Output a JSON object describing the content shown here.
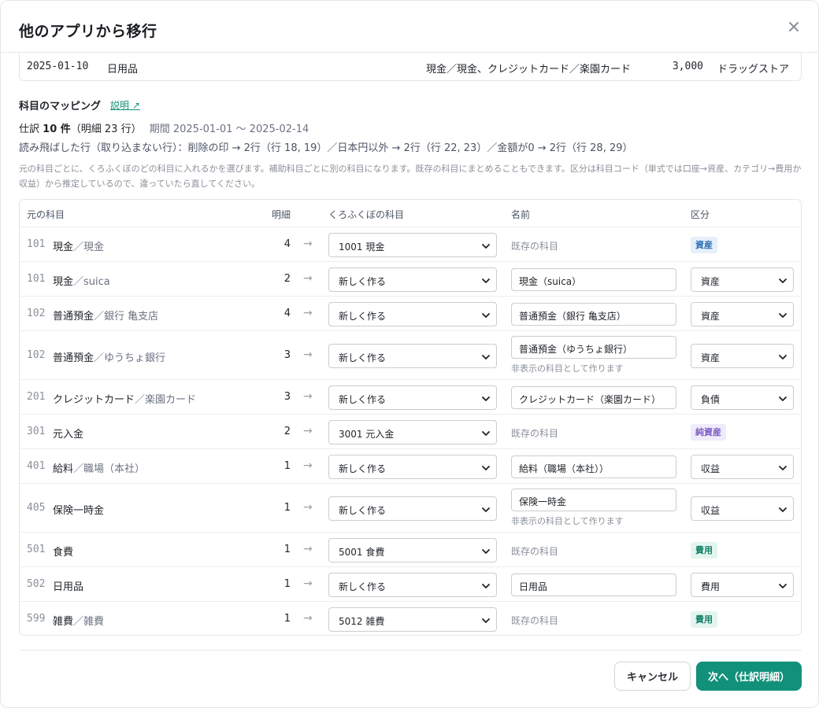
{
  "dialog": {
    "title": "他のアプリから移行",
    "close_label": "×"
  },
  "preview_row": {
    "date": "2025-01-10",
    "memo": "日用品",
    "accounts": "現金／現金、クレジットカード／楽園カード",
    "amount": "3,000",
    "payee": "ドラッグストア"
  },
  "mapping": {
    "title": "科目のマッピング",
    "help_link": "説明 ↗",
    "summary_prefix": "仕訳",
    "summary_count": "10 件",
    "summary_detail": "（明細 23 行）",
    "summary_period": "期間 2025-01-01 〜 2025-02-14",
    "skipped": "読み飛ばした行（取り込まない行）：削除の印 → 2行（行 18, 19）／日本円以外 → 2行（行 22, 23）／金額が0 → 2行（行 28, 29）",
    "description": "元の科目ごとに、くろふくぼのどの科目に入れるかを選びます。補助科目ごとに別の科目になります。既存の科目にまとめることもできます。区分は科目コード（単式では口座→資産、カテゴリ→費用か収益）から推定しているので、違っていたら直してください。"
  },
  "table": {
    "headers": {
      "source": "元の科目",
      "count": "明細",
      "target": "くろふくぼの科目",
      "name": "名前",
      "category": "区分"
    },
    "arrow": "→",
    "existing_label": "既存の科目",
    "hidden_hint": "非表示の科目として作ります",
    "rows": [
      {
        "code": "101",
        "main": "現金",
        "sub": "／現金",
        "count": "4",
        "target": "1001 現金",
        "name": "",
        "category": "資産",
        "hint": ""
      },
      {
        "code": "101",
        "main": "現金",
        "sub": "／suica",
        "count": "2",
        "target": "新しく作る",
        "name": "現金（suica）",
        "category": "資産",
        "hint": ""
      },
      {
        "code": "102",
        "main": "普通預金",
        "sub": "／銀行 亀支店",
        "count": "4",
        "target": "新しく作る",
        "name": "普通預金（銀行 亀支店）",
        "category": "資産",
        "hint": ""
      },
      {
        "code": "102",
        "main": "普通預金",
        "sub": "／ゆうちょ銀行",
        "count": "3",
        "target": "新しく作る",
        "name": "普通預金（ゆうちょ銀行）",
        "category": "資産",
        "hint": "非表示の科目として作ります"
      },
      {
        "code": "201",
        "main": "クレジットカード",
        "sub": "／楽園カード",
        "count": "3",
        "target": "新しく作る",
        "name": "クレジットカード（楽園カード）",
        "category": "負債",
        "hint": ""
      },
      {
        "code": "301",
        "main": "元入金",
        "sub": "",
        "count": "2",
        "target": "3001 元入金",
        "name": "",
        "category": "純資産",
        "hint": ""
      },
      {
        "code": "401",
        "main": "給料",
        "sub": "／職場（本社）",
        "count": "1",
        "target": "新しく作る",
        "name": "給料（職場（本社））",
        "category": "収益",
        "hint": ""
      },
      {
        "code": "405",
        "main": "保険一時金",
        "sub": "",
        "count": "1",
        "target": "新しく作る",
        "name": "保険一時金",
        "category": "収益",
        "hint": "非表示の科目として作ります"
      },
      {
        "code": "501",
        "main": "食費",
        "sub": "",
        "count": "1",
        "target": "5001 食費",
        "name": "",
        "category": "費用",
        "hint": ""
      },
      {
        "code": "502",
        "main": "日用品",
        "sub": "",
        "count": "1",
        "target": "新しく作る",
        "name": "日用品",
        "category": "費用",
        "hint": ""
      },
      {
        "code": "599",
        "main": "雑費",
        "sub": "／雑費",
        "count": "1",
        "target": "5012 雑費",
        "name": "",
        "category": "費用",
        "hint": ""
      }
    ]
  },
  "footer": {
    "cancel_label": "キャンセル",
    "next_label": "次へ（仕訳明細）"
  },
  "colors": {
    "accent": "#12917a",
    "asset_badge": "#2f6fb6",
    "equity_badge": "#7b5cc4",
    "expense_badge": "#16806a"
  }
}
